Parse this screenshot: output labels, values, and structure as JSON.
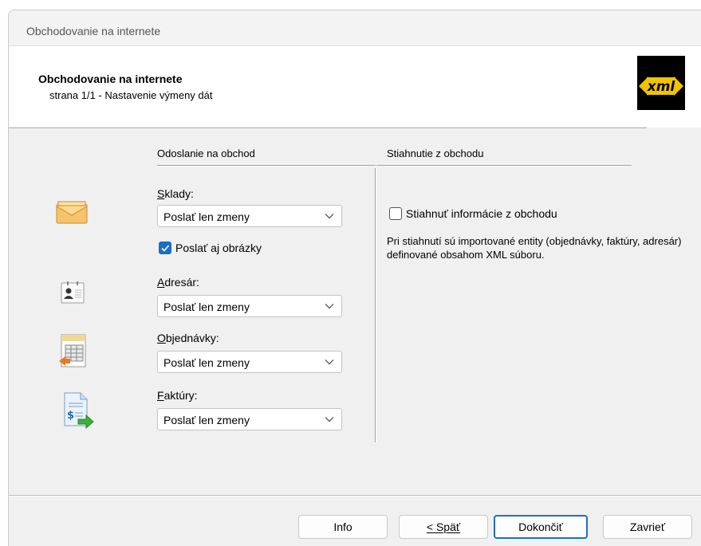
{
  "window": {
    "title": "Obchodovanie na internete"
  },
  "header": {
    "title": "Obchodovanie na internete",
    "subtitle": "strana 1/1 - Nastavenie výmeny dát",
    "logo_text": "xml"
  },
  "upload": {
    "heading": "Odoslanie na obchod",
    "sections": [
      {
        "label": "Sklady:",
        "accel": "S",
        "rest": "klady:",
        "value": "Poslať len zmeny",
        "icon": "package-icon"
      },
      {
        "label": "Adresár:",
        "accel": "A",
        "rest": "dresár:",
        "value": "Poslať len zmeny",
        "icon": "contact-card-icon"
      },
      {
        "label": "Objednávky:",
        "accel": "O",
        "rest": "bjednávky:",
        "value": "Poslať len zmeny",
        "icon": "order-document-icon"
      },
      {
        "label": "Faktúry:",
        "accel": "F",
        "rest": "aktúry:",
        "value": "Poslať len zmeny",
        "icon": "invoice-icon"
      }
    ],
    "send_images": {
      "label": "Poslať aj obrázky",
      "checked": true
    }
  },
  "download": {
    "heading": "Stiahnutie z obchodu",
    "checkbox": {
      "label": "Stiahnuť informácie z obchodu",
      "checked": false
    },
    "description": "Pri stiahnutí sú importované entity (objednávky, faktúry, adresár) definované obsahom XML súboru."
  },
  "buttons": {
    "info": "Info",
    "back": "< Späť",
    "finish": "Dokončiť",
    "close": "Zavrieť"
  },
  "colors": {
    "accent": "#1a6fc4",
    "logo_bg": "#000000",
    "logo_fg": "#f2c200"
  }
}
